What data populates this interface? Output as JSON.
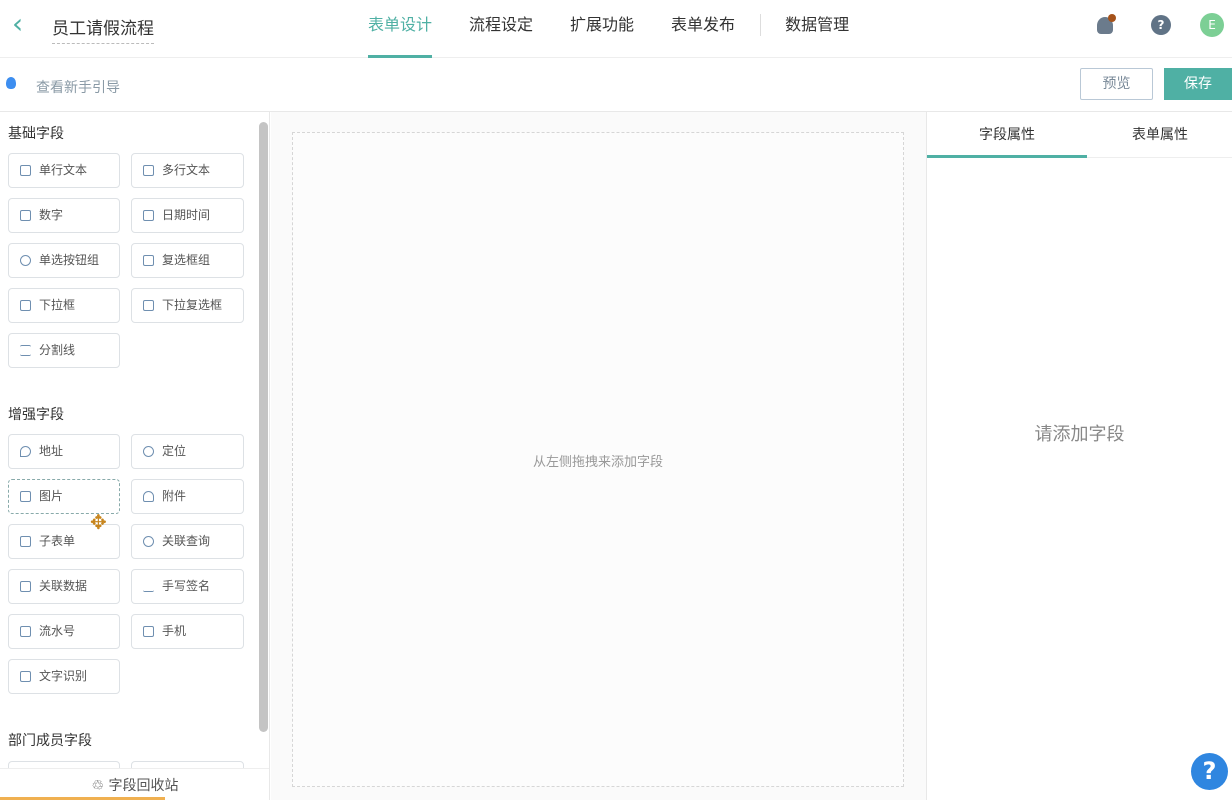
{
  "header": {
    "title": "员工请假流程",
    "tabs": [
      "表单设计",
      "流程设定",
      "扩展功能",
      "表单发布",
      "数据管理"
    ],
    "active_tab": 0,
    "avatar_letter": "E",
    "help": "?"
  },
  "toolbar": {
    "guide": "查看新手引导",
    "preview": "预览",
    "save": "保存"
  },
  "colors": {
    "accent": "#4fb0a4"
  },
  "sections": [
    {
      "title": "基础字段",
      "fields": [
        "单行文本",
        "多行文本",
        "数字",
        "日期时间",
        "单选按钮组",
        "复选框组",
        "下拉框",
        "下拉复选框",
        "分割线"
      ]
    },
    {
      "title": "增强字段",
      "fields": [
        "地址",
        "定位",
        "图片",
        "附件",
        "子表单",
        "关联查询",
        "关联数据",
        "手写签名",
        "流水号",
        "手机",
        "文字识别"
      ]
    },
    {
      "title": "部门成员字段",
      "fields": []
    }
  ],
  "recycle": "字段回收站",
  "canvas": {
    "placeholder": "从左侧拖拽来添加字段"
  },
  "right": {
    "tabs": [
      "字段属性",
      "表单属性"
    ],
    "empty": "请添加字段"
  },
  "fab": "?"
}
